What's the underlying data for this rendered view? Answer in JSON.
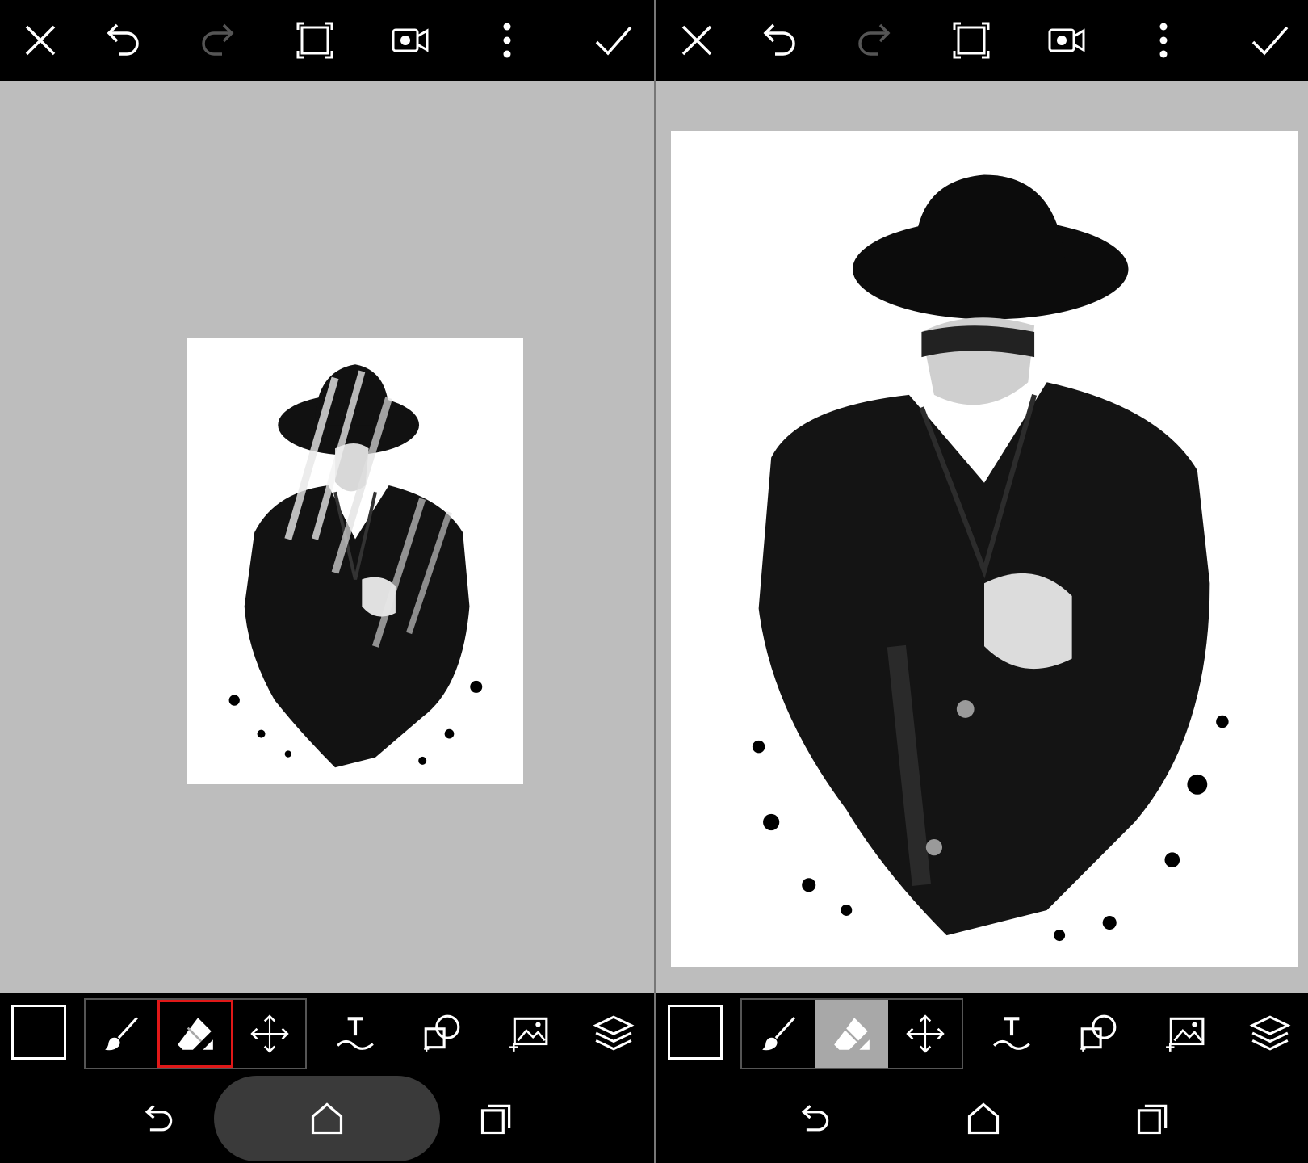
{
  "panels": [
    {
      "id": "left",
      "topbar": [
        "close-icon",
        "undo-icon",
        "redo-icon",
        "crop-icon",
        "video-record-icon",
        "more-vertical-icon",
        "check-icon"
      ],
      "toolbar": {
        "color_swatch": "#000000",
        "brush_group": [
          {
            "name": "brush-tool",
            "icon": "brush-icon",
            "state": "normal"
          },
          {
            "name": "eraser-tool",
            "icon": "eraser-icon",
            "state": "selected-highlight"
          },
          {
            "name": "move-tool",
            "icon": "move-icon",
            "state": "normal"
          }
        ],
        "tools": [
          "text-icon",
          "shape-icon",
          "add-photo-icon",
          "layers-icon"
        ]
      },
      "navbar": [
        "back-icon",
        "home-icon",
        "recents-icon"
      ],
      "home_pill_visible": true
    },
    {
      "id": "right",
      "topbar": [
        "close-icon",
        "undo-icon",
        "redo-icon",
        "crop-icon",
        "video-record-icon",
        "more-vertical-icon",
        "check-icon"
      ],
      "toolbar": {
        "color_swatch": "#000000",
        "brush_group": [
          {
            "name": "brush-tool",
            "icon": "brush-icon",
            "state": "normal"
          },
          {
            "name": "eraser-tool",
            "icon": "eraser-icon",
            "state": "active"
          },
          {
            "name": "move-tool",
            "icon": "move-icon",
            "state": "normal"
          }
        ],
        "tools": [
          "text-icon",
          "shape-icon",
          "add-photo-icon",
          "layers-icon"
        ]
      },
      "navbar": [
        "back-icon",
        "home-icon",
        "recents-icon"
      ],
      "home_pill_visible": false
    }
  ],
  "colors": {
    "background": "#000000",
    "canvas_area": "#bdbdbd",
    "icon": "#ffffff",
    "icon_disabled": "#555555",
    "active_tool_bg": "#a8a8a8",
    "selection_border": "#e01818"
  }
}
